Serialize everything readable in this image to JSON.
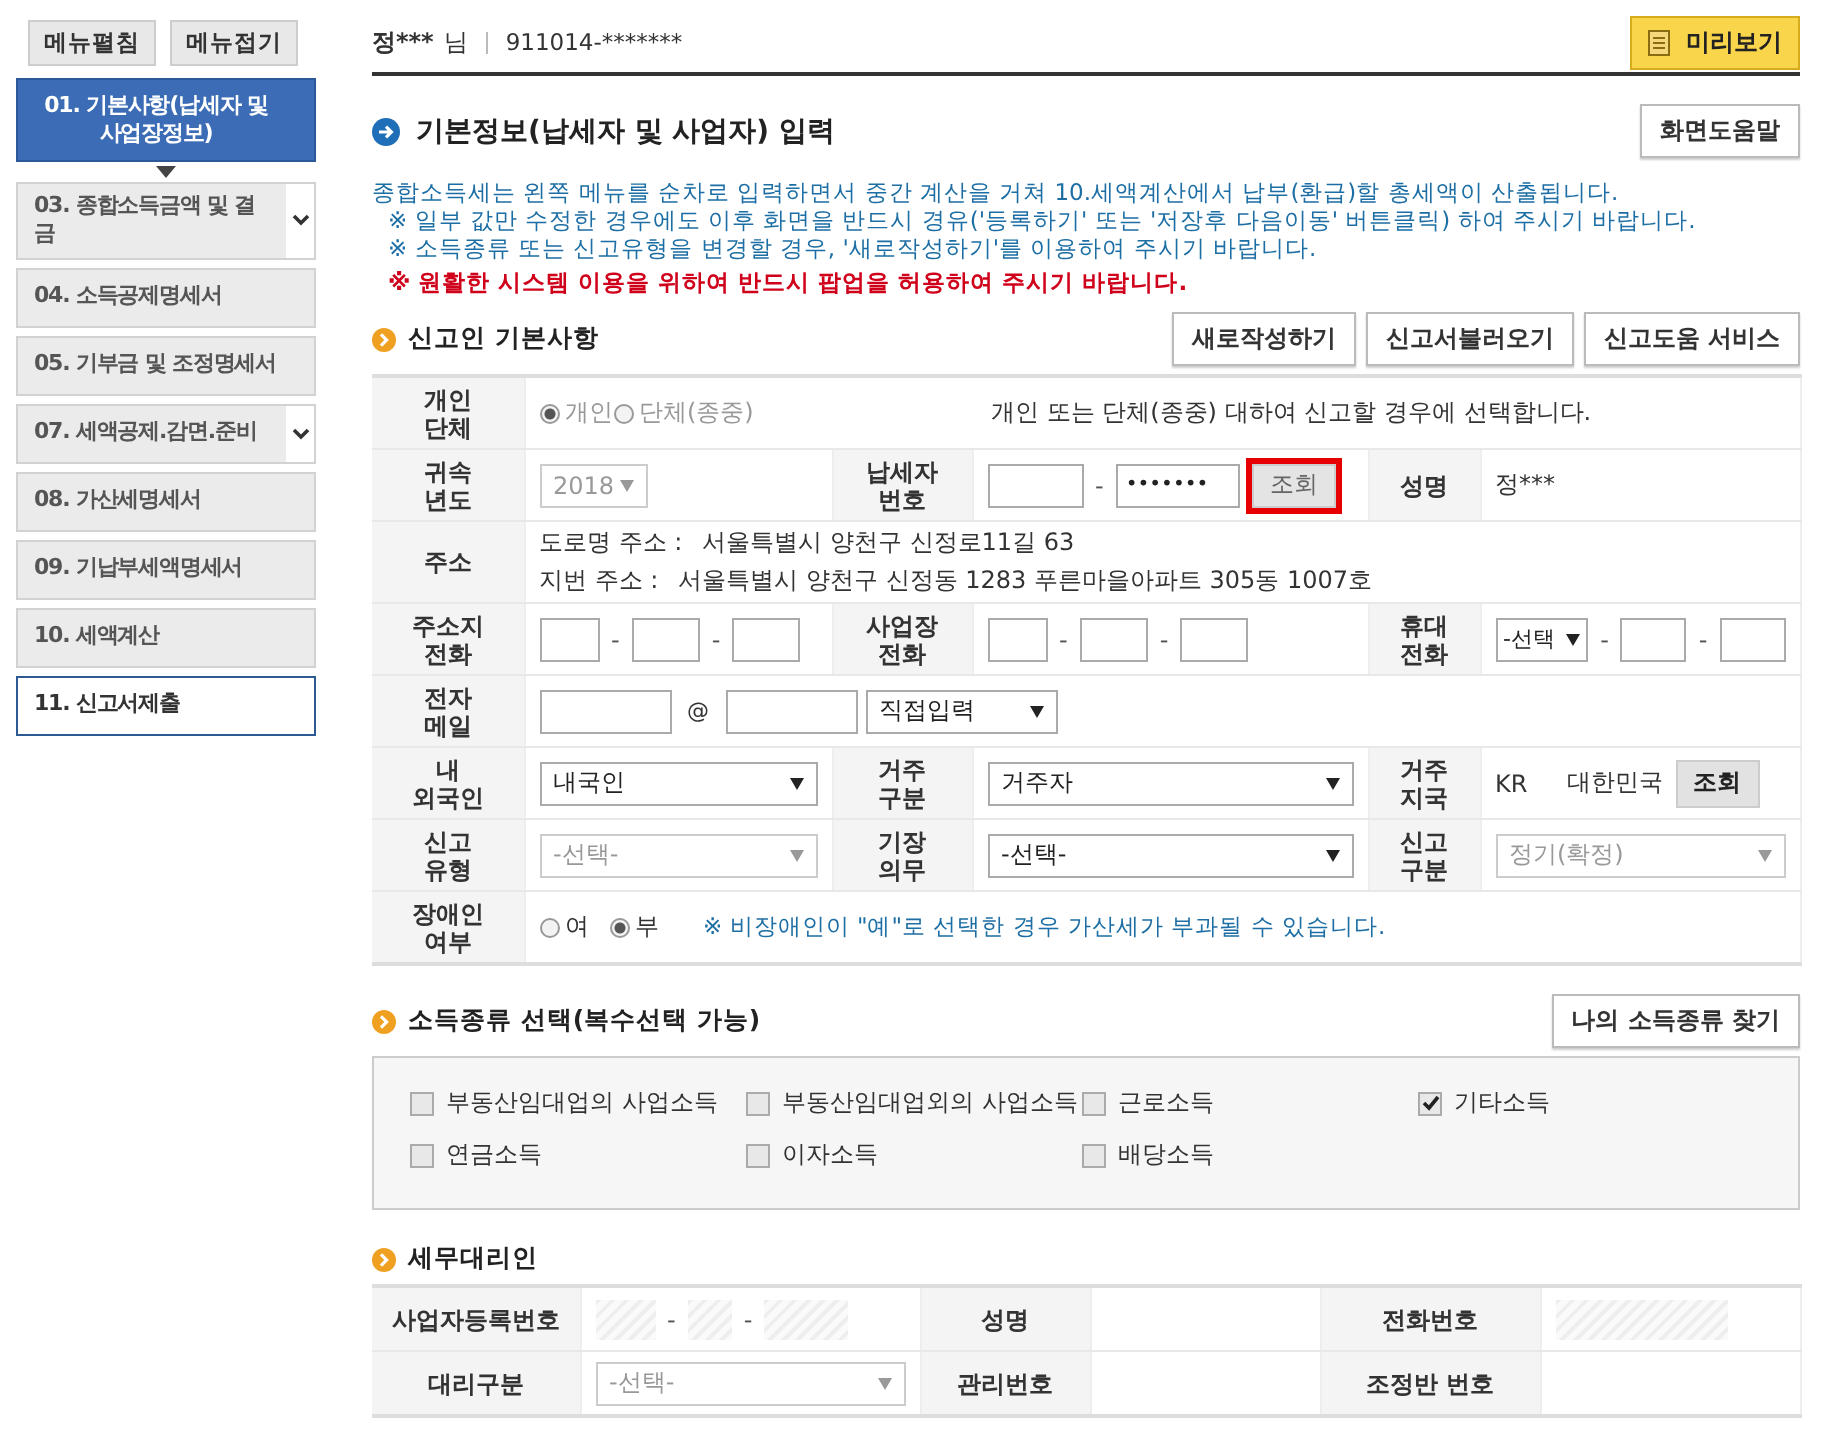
{
  "sidebar": {
    "buttons": [
      "메뉴펼침",
      "메뉴접기"
    ],
    "items": [
      {
        "label": "01. 기본사항(납세자 및 사업장정보)",
        "selected": true,
        "dropdown": false,
        "outlined": false
      },
      {
        "label": "03. 종합소득금액 및 결\n금",
        "selected": false,
        "dropdown": true,
        "outlined": false
      },
      {
        "label": "04. 소득공제명세서",
        "selected": false,
        "dropdown": false,
        "outlined": false
      },
      {
        "label": "05. 기부금 및 조정명세서",
        "selected": false,
        "dropdown": false,
        "outlined": false
      },
      {
        "label": "07. 세액공제.감면.준비",
        "selected": false,
        "dropdown": true,
        "outlined": false
      },
      {
        "label": "08. 가산세명세서",
        "selected": false,
        "dropdown": false,
        "outlined": false
      },
      {
        "label": "09. 기납부세액명세서",
        "selected": false,
        "dropdown": false,
        "outlined": false
      },
      {
        "label": "10. 세액계산",
        "selected": false,
        "dropdown": false,
        "outlined": false
      },
      {
        "label": "11. 신고서제출",
        "selected": false,
        "dropdown": false,
        "outlined": true
      }
    ]
  },
  "header": {
    "name": "정***",
    "suffix": "님",
    "id": "911014-*******",
    "preview_button": "미리보기"
  },
  "page_title": "기본정보(납세자 및 사업자) 입력",
  "help_button": "화면도움말",
  "notices": [
    {
      "text": "종합소득세는 왼쪽 메뉴를 순차로 입력하면서 중간 계산을 거쳐 10.세액계산에서 납부(환급)할 총세액이 산출됩니다.",
      "kind": "info"
    },
    {
      "text": "※ 일부 값만 수정한 경우에도 이후 화면을 반드시 경유('등록하기' 또는 '저장후 다음이동' 버튼클릭) 하여 주시기 바랍니다.",
      "kind": "sub"
    },
    {
      "text": "※ 소득종류 또는 신고유형을 변경할 경우, '새로작성하기'를 이용하여 주시기 바랍니다.",
      "kind": "sub"
    },
    {
      "text": "※ 원활한 시스템 이용을 위하여 반드시 팝업을 허용하여 주시기 바랍니다.",
      "kind": "warning"
    }
  ],
  "basic_info": {
    "title": "신고인 기본사항",
    "buttons": [
      "새로작성하기",
      "신고서불러오기",
      "신고도움 서비스"
    ],
    "rows": [
      {
        "cells": [
          {
            "label": "개인 단체",
            "field": {
              "kind": "radio",
              "disabled": true,
              "options": [
                {
                  "label": "개인",
                  "selected": true
                },
                {
                  "label": "단체(종중)",
                  "selected": false
                }
              ],
              "hint": "개인 또는 단체(종중) 대하여 신고할 경우에 선택합니다."
            }
          }
        ]
      },
      {
        "cells": [
          {
            "label": "귀속 년도",
            "field": {
              "kind": "short_select",
              "value": "2018",
              "disabled": true
            }
          },
          {
            "label": "납세자 번호",
            "field": {
              "kind": "id_number",
              "separator": "-",
              "masked": "•••••••",
              "button": "조회",
              "highlighted": true
            }
          },
          {
            "label": "성명",
            "field": {
              "kind": "text",
              "text": "정***"
            }
          }
        ]
      },
      {
        "cells": [
          {
            "label": "주소",
            "field": {
              "kind": "address",
              "lines": [
                {
                  "label": "도로명 주소 :",
                  "value": "서울특별시 양천구 신정로11길 63"
                },
                {
                  "label": "지번 주소 :",
                  "value": "서울특별시 양천구 신정동 1283 푸른마을아파트 305동 1007호"
                }
              ]
            }
          }
        ]
      },
      {
        "cells": [
          {
            "label": "주소지 전화",
            "field": {
              "kind": "phone",
              "separator": "-"
            }
          },
          {
            "label": "사업장 전화",
            "field": {
              "kind": "phone",
              "separator": "-"
            }
          },
          {
            "label": "휴대 전화",
            "field": {
              "kind": "mobile",
              "value": "-선택",
              "separator": "-"
            }
          }
        ]
      },
      {
        "cells": [
          {
            "label": "전자 메일",
            "field": {
              "kind": "email",
              "at": "@",
              "domain": "직접입력"
            }
          }
        ]
      },
      {
        "cells": [
          {
            "label": "내 외국인",
            "field": {
              "kind": "select",
              "value": "내국인",
              "disabled": false
            }
          },
          {
            "label": "거주 구분",
            "field": {
              "kind": "select",
              "value": "거주자",
              "disabled": false
            }
          },
          {
            "label": "거주 지국",
            "field": {
              "kind": "country",
              "code": "KR",
              "name": "대한민국",
              "button": "조회"
            }
          }
        ]
      },
      {
        "cells": [
          {
            "label": "신고 유형",
            "field": {
              "kind": "select",
              "value": "-선택-",
              "disabled": true
            }
          },
          {
            "label": "기장 의무",
            "field": {
              "kind": "select",
              "value": "-선택-",
              "disabled": false
            }
          },
          {
            "label": "신고 구분",
            "field": {
              "kind": "select",
              "value": "정기(확정)",
              "disabled": true
            }
          }
        ]
      },
      {
        "cells": [
          {
            "label": "장애인 여부",
            "field": {
              "kind": "radio",
              "disabled": false,
              "options": [
                {
                  "label": "여",
                  "selected": false
                },
                {
                  "label": "부",
                  "selected": true
                }
              ],
              "note": "※ 비장애인이 \"예\"로 선택한 경우 가산세가 부과될 수 있습니다."
            }
          }
        ]
      }
    ]
  },
  "income_types": {
    "title": "소득종류 선택(복수선택 가능)",
    "button": "나의 소득종류 찾기",
    "options": [
      {
        "label": "부동산임대업의 사업소득",
        "checked": false
      },
      {
        "label": "부동산임대업외의 사업소득",
        "checked": false
      },
      {
        "label": "근로소득",
        "checked": false
      },
      {
        "label": "기타소득",
        "checked": true
      },
      {
        "label": "연금소득",
        "checked": false
      },
      {
        "label": "이자소득",
        "checked": false
      },
      {
        "label": "배당소득",
        "checked": false
      }
    ]
  },
  "tax_agent": {
    "title": "세무대리인",
    "rows": [
      {
        "cells": [
          {
            "label": "사업자등록번호",
            "field": {
              "kind": "hatched_id",
              "separator": "-"
            }
          },
          {
            "label": "성명"
          },
          {
            "label": "전화번호",
            "field": {
              "kind": "hatched"
            }
          }
        ]
      },
      {
        "cells": [
          {
            "label": "대리구분",
            "field": {
              "kind": "select",
              "value": "-선택-",
              "disabled": true
            }
          },
          {
            "label": "관리번호"
          },
          {
            "label": "조정반 번호"
          }
        ]
      }
    ]
  }
}
